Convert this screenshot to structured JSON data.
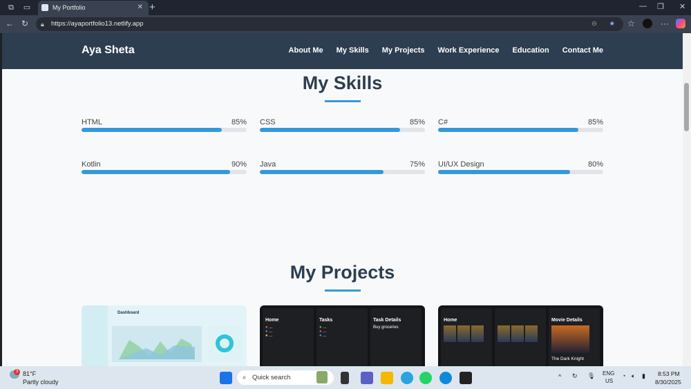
{
  "browser": {
    "tab_title": "My Portfolio",
    "url": "https://ayaportfolio13.netlify.app"
  },
  "site": {
    "brand": "Aya Sheta",
    "nav": [
      "About Me",
      "My Skills",
      "My Projects",
      "Work Experience",
      "Education",
      "Contact Me"
    ]
  },
  "skills": {
    "title": "My Skills",
    "items": [
      {
        "name": "HTML",
        "percent": 85
      },
      {
        "name": "CSS",
        "percent": 85
      },
      {
        "name": "C#",
        "percent": 85
      },
      {
        "name": "Kotlin",
        "percent": 90
      },
      {
        "name": "Java",
        "percent": 75
      },
      {
        "name": "UI/UX Design",
        "percent": 80
      }
    ]
  },
  "projects": {
    "title": "My Projects",
    "cards": [
      {
        "dashboard_title": "Dashboard"
      },
      {
        "screens": [
          "Home",
          "Tasks",
          "Task Details"
        ],
        "detail": "Buy groceries"
      },
      {
        "screens": [
          "Home",
          "",
          "Movie Details"
        ],
        "movie": "The Dark Knight"
      }
    ]
  },
  "taskbar": {
    "weather_temp": "81°F",
    "weather_desc": "Partly cloudy",
    "weather_badge": "3",
    "search": "Quick search",
    "lang1": "ENG",
    "lang2": "US",
    "time": "8:53 PM",
    "date": "8/30/2025"
  },
  "colors": {
    "nav": "#2c3e50",
    "accent": "#3498db"
  }
}
